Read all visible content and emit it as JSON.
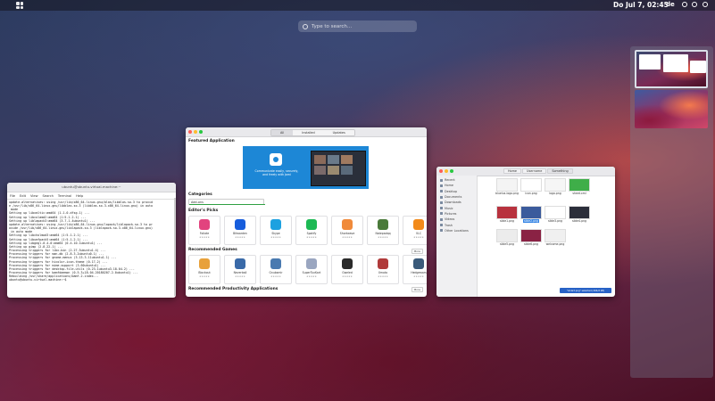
{
  "topbar": {
    "clock": "Do Jul  7, 02:45",
    "language": "de"
  },
  "search": {
    "placeholder": "Type to search…"
  },
  "terminal": {
    "title": "ubuntu@ubuntu-virtual-machine:~",
    "menu": [
      "File",
      "Edit",
      "View",
      "Search",
      "Terminal",
      "Help"
    ],
    "lines": [
      "update-alternatives: using /usr/lib/x86_64-linux-gnu/blas/libblas.so.3 to provid",
      "e /usr/lib/x86_64-linux-gnu/libblas.so.3 (libblas.so.3-x86_64-linux-gnu) in auto",
      " mode",
      "Setting up libxmltic:amd64 (1.1.0.dfsg-1) ...",
      "Setting up libcolamd2:amd64 (1:5.1.2-1) ...",
      "Setting up liblapack3:amd64 (3.7.1-4ubuntu1) ...",
      "update-alternatives: using /usr/lib/x86_64-linux-gnu/lapack/liblapack.so.3 to pr",
      "ovide /usr/lib/x86_64-linux-gnu/liblapack.so.3 (liblapack.so.3-x86_64-linux-gnu)",
      " in auto mode",
      "Setting up libcholmod3:amd64 (1:5.1.2-1) ...",
      "Setting up libumfpack5:amd64 (1:5.1.2-1) ...",
      "Setting up libgegl-0.4-0:amd64 (0.4.10-1ubuntu1) ...",
      "Setting up gimp (2.8.22-1) ...",
      "Processing triggers for libc-bin (2.27-3ubuntu1.4) ...",
      "Processing triggers for man-db (2.8.3-2ubuntu0.1) ...",
      "Processing triggers for gnome-menus (3.13.3-11ubuntu1.1) ...",
      "Processing triggers for hicolor-icon-theme (0.17-2) ...",
      "Processing triggers for mime-support (3.60ubuntu1) ...",
      "Processing triggers for desktop-file-utils (0.23-1ubuntu3.18.04.2) ...",
      "Processing triggers for bamfdaemon (0.5.3+18.04.20180207.2-0ubuntu1) ...",
      "Rebuilding /usr/share/applications/bamf-2.index...",
      "ubuntu@ubuntu-virtual-machine:~$ "
    ]
  },
  "store": {
    "tabs": [
      "All",
      "Installed",
      "Updates"
    ],
    "featured_title": "Featured Application",
    "banner_text": "Communicate easily, securely, and freely with Jami",
    "categories_title": "Categories",
    "category_value": "Add-ons",
    "editors_title": "Editor's Picks",
    "editors": [
      {
        "name": "Foliate",
        "color": "#e2437e"
      },
      {
        "name": "Bitwarden",
        "color": "#175ddc"
      },
      {
        "name": "Skype",
        "color": "#1da1e0"
      },
      {
        "name": "Spotify",
        "color": "#1db954"
      },
      {
        "name": "Shortwave",
        "color": "#f08a3a"
      },
      {
        "name": "Notepadqq",
        "color": "#4a7a3a"
      },
      {
        "name": "VLC",
        "color": "#f28a1a"
      }
    ],
    "games_title": "Recommended Games",
    "games": [
      {
        "name": "Blockout",
        "color": "#e8a13a"
      },
      {
        "name": "Neverball",
        "color": "#3a6aa8"
      },
      {
        "name": "Gnubsmir",
        "color": "#4a7ab0"
      },
      {
        "name": "SuperTuxKart",
        "color": "#9aa6c0"
      },
      {
        "name": "Gweled",
        "color": "#2a2a2a"
      },
      {
        "name": "Xmoto",
        "color": "#b03a3a"
      },
      {
        "name": "Hedgewars",
        "color": "#3a5a7a"
      }
    ],
    "more_label": "More",
    "productivity_title": "Recommended Productivity Applications"
  },
  "files": {
    "sidebar": [
      "Recent",
      "Home",
      "Desktop",
      "Documents",
      "Downloads",
      "Music",
      "Pictures",
      "Videos",
      "Trash",
      "Other Locations"
    ],
    "path": [
      "Home",
      "Username",
      "Something"
    ],
    "items": [
      {
        "name": "bluelux-logo.png",
        "color": "#f4f4f4"
      },
      {
        "name": "icon.png",
        "color": "#ffffff"
      },
      {
        "name": "logo.png",
        "color": "#f6f6f6"
      },
      {
        "name": "sheet.xml",
        "color": "#3fae49"
      },
      {
        "name": "slide1.png",
        "color": "#b8323e"
      },
      {
        "name": "slide2.png",
        "color": "#3b5b9c"
      },
      {
        "name": "slide3.png",
        "color": "#ffffff"
      },
      {
        "name": "slide4.png",
        "color": "#2b2e3a"
      },
      {
        "name": "slide5.png",
        "color": "#ececec"
      },
      {
        "name": "slide6.png",
        "color": "#8a2244"
      },
      {
        "name": "welcome.png",
        "color": "#f0f0f0"
      }
    ],
    "selected_index": 5,
    "status": "\"slide3.png\" selected (266,8 kB)"
  }
}
